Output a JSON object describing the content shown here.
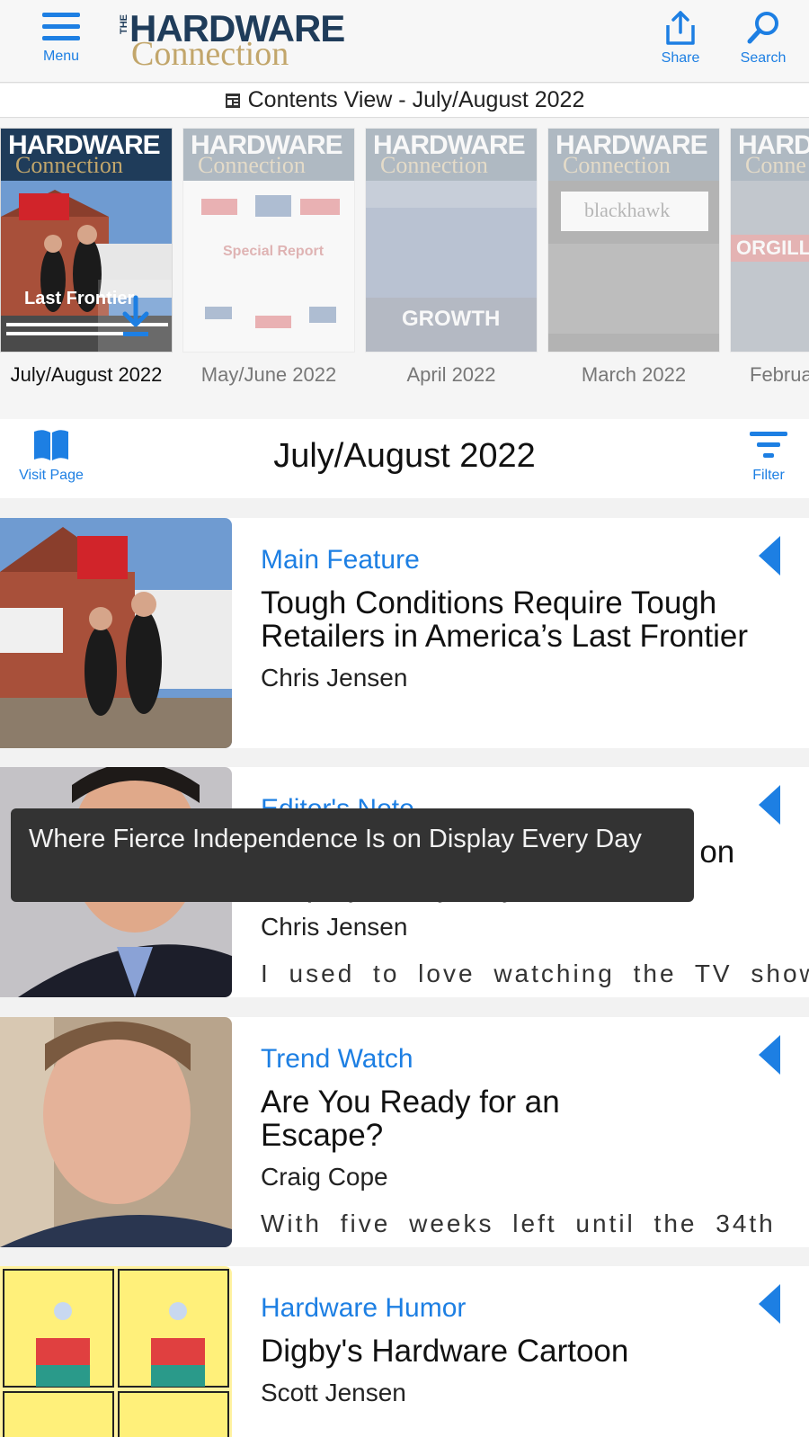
{
  "header": {
    "menu_label": "Menu",
    "logo_the": "THE",
    "logo_title": "HARDWARE",
    "logo_subtitle": "Connection",
    "share_label": "Share",
    "search_label": "Search",
    "accent_color": "#1d7fe3"
  },
  "contents_bar": {
    "text": "Contents View - July/August 2022",
    "icon": "document-icon"
  },
  "issues": [
    {
      "label": "July/August 2022",
      "active": true,
      "cover_masthead": "HARDWARE",
      "cover_sub": "Connection",
      "cover_headline": "Last Frontier"
    },
    {
      "label": "May/June 2022",
      "active": false,
      "cover_masthead": "HARDWARE",
      "cover_sub": "Connection",
      "cover_headline": "Special Report"
    },
    {
      "label": "April 2022",
      "active": false,
      "cover_masthead": "HARDWARE",
      "cover_sub": "Connection",
      "cover_headline": "GROWTH"
    },
    {
      "label": "March 2022",
      "active": false,
      "cover_masthead": "HARDWARE",
      "cover_sub": "Connection",
      "cover_headline": "blackhawk"
    },
    {
      "label": "Februa",
      "active": false,
      "cover_masthead": "HARD",
      "cover_sub": "Conne",
      "cover_headline": "ORGILL"
    }
  ],
  "issue_bar": {
    "visit_label": "Visit Page",
    "title": "July/August 2022",
    "filter_label": "Filter"
  },
  "articles": [
    {
      "category": "Main Feature",
      "title": "Tough Conditions Require Tough Retailers in America’s Last Frontier",
      "author": "Chris Jensen",
      "snippet": ""
    },
    {
      "category": "Editor's Note",
      "title": "Where Fierce Independence Is on Display Every Day",
      "author": "Chris Jensen",
      "snippet": "I used to love watching the TV show"
    },
    {
      "category": "Trend Watch",
      "title": "Are You Ready for an Escape?",
      "author": "Craig Cope",
      "snippet": "With five weeks left until the 34th"
    },
    {
      "category": "Hardware Humor",
      "title": "Digby's Hardware Cartoon",
      "author": "Scott Jensen",
      "snippet": ""
    }
  ],
  "tooltip": {
    "text": "Where Fierce Independence Is on Display Every Day"
  }
}
